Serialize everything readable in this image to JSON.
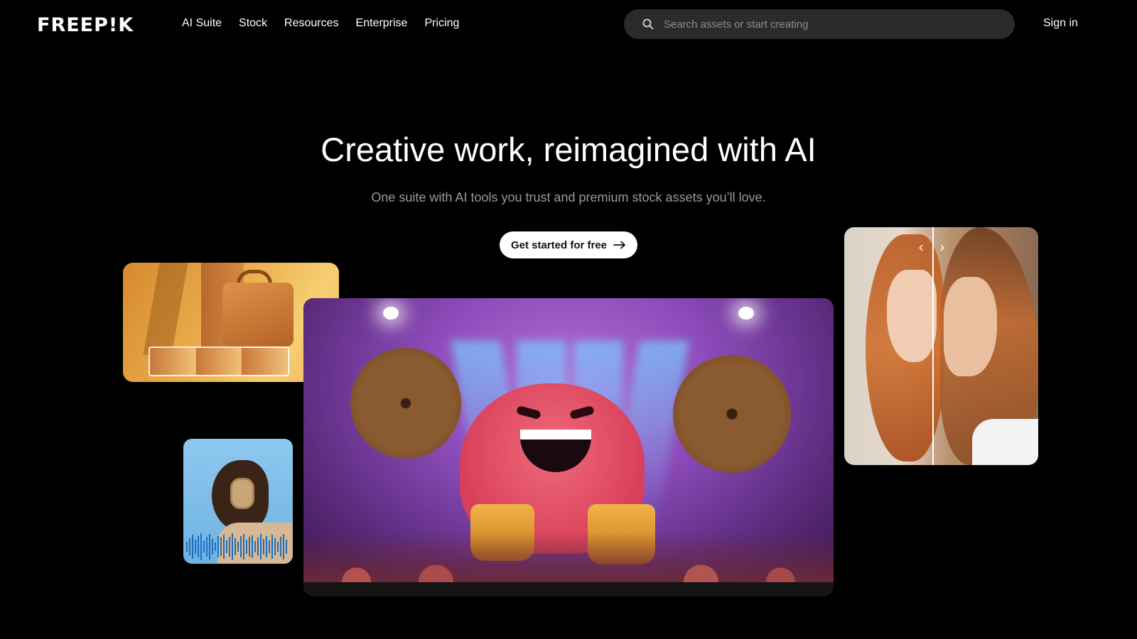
{
  "header": {
    "logo": "FREEP!K",
    "nav": [
      "AI Suite",
      "Stock",
      "Resources",
      "Enterprise",
      "Pricing"
    ],
    "search_placeholder": "Search assets or start creating",
    "signin": "Sign in"
  },
  "hero": {
    "title": "Creative work, reimagined with AI",
    "subtitle": "One suite with AI tools you trust and premium stock assets you’ll love.",
    "cta_label": "Get started for free",
    "cta_icon": "arrow-right-icon"
  },
  "cards": {
    "bag_icon": "handbag-image",
    "drum_icon": "drummer-monster-video",
    "audio_icon": "headphones-audio-image",
    "portrait_icon": "before-after-portrait",
    "compare_left_icon": "chevron-left-icon",
    "compare_right_icon": "chevron-right-icon"
  },
  "colors": {
    "background": "#000000",
    "search_bg": "#2b2b2b",
    "cta_bg": "#ffffff",
    "subtitle": "#9a9a9a"
  }
}
